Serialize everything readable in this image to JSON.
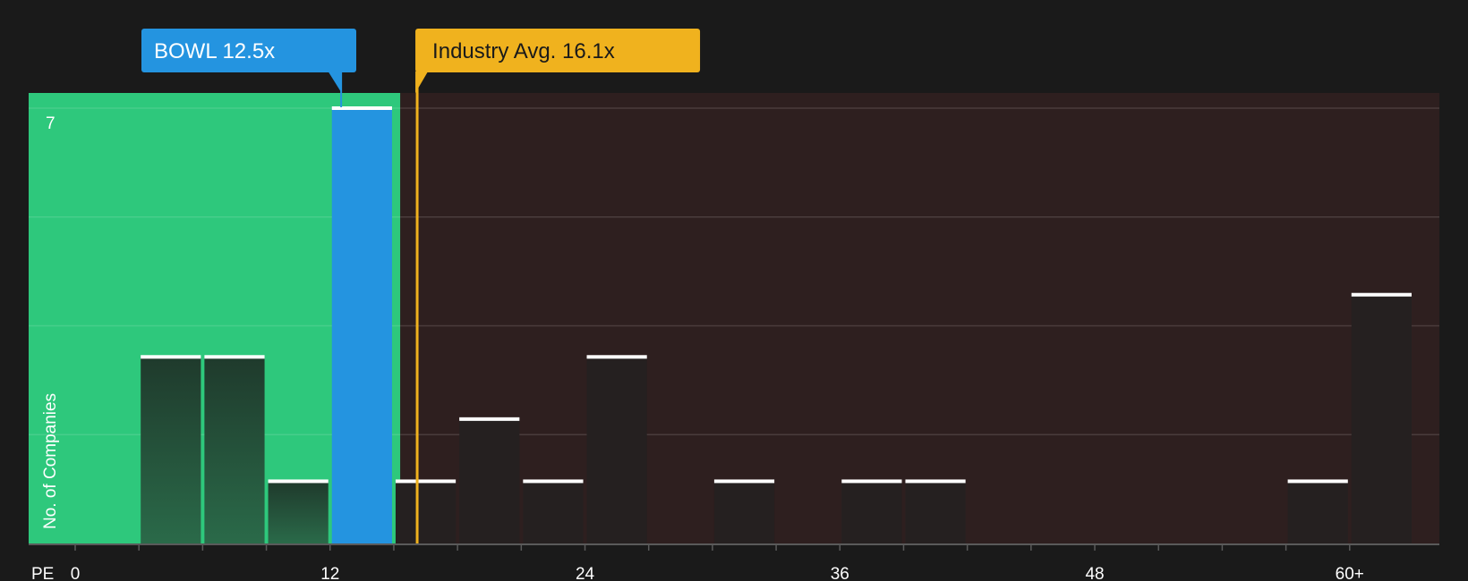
{
  "chart_data": {
    "type": "bar",
    "x_axis_label": "PE",
    "y_axis_label": "No. of Companies",
    "x_ticks": [
      "0",
      "12",
      "24",
      "36",
      "48",
      "60+"
    ],
    "y_tick_labels": [
      "7"
    ],
    "ylim": [
      0,
      7
    ],
    "bin_width": 3,
    "bins": [
      {
        "start": 3,
        "count": 3
      },
      {
        "start": 6,
        "count": 3
      },
      {
        "start": 9,
        "count": 1
      },
      {
        "start": 12,
        "count": 7
      },
      {
        "start": 15,
        "count": 1
      },
      {
        "start": 18,
        "count": 2
      },
      {
        "start": 21,
        "count": 1
      },
      {
        "start": 24,
        "count": 3
      },
      {
        "start": 30,
        "count": 1
      },
      {
        "start": 36,
        "count": 1
      },
      {
        "start": 39,
        "count": 1
      },
      {
        "start": 57,
        "count": 1
      },
      {
        "start": 60,
        "count": 4
      }
    ],
    "company": {
      "label": "BOWL 12.5x",
      "value": 12.5
    },
    "industry_avg": {
      "label": "Industry Avg. 16.1x",
      "value": 16.1
    },
    "fair_zone_end": 15.3
  },
  "colors": {
    "background": "#1a1a1a",
    "fair_zone": "#2ec87c",
    "premium_zone": "#2e1f1f",
    "company": "#2494e0",
    "industry": "#f0b21e",
    "bar_in_zone": "#24553d",
    "bar_other": "#252020",
    "bar_cap": "#ffffff",
    "grid": "#4a3c3c",
    "axis": "#5a5a5a"
  }
}
